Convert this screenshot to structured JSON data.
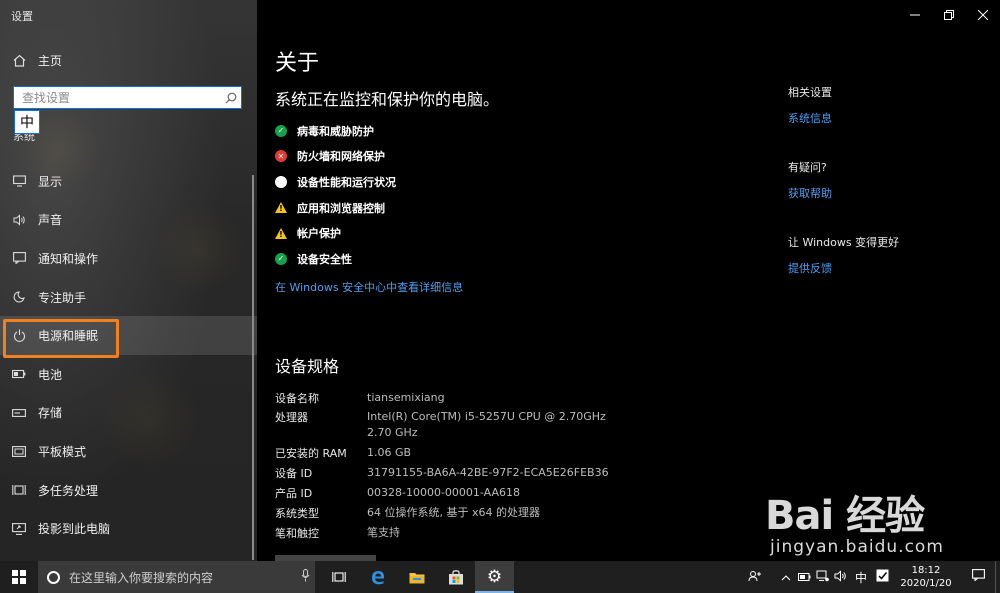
{
  "window": {
    "title": "设置"
  },
  "sidebar": {
    "home_label": "主页",
    "search_placeholder": "查找设置",
    "ime_char": "中",
    "section_label": "系统",
    "items": [
      {
        "label": "显示",
        "icon": "monitor-icon"
      },
      {
        "label": "声音",
        "icon": "speaker-icon"
      },
      {
        "label": "通知和操作",
        "icon": "notification-icon"
      },
      {
        "label": "专注助手",
        "icon": "moon-icon"
      },
      {
        "label": "电源和睡眠",
        "icon": "power-icon",
        "selected": true
      },
      {
        "label": "电池",
        "icon": "battery-icon"
      },
      {
        "label": "存储",
        "icon": "storage-icon"
      },
      {
        "label": "平板模式",
        "icon": "tablet-icon"
      },
      {
        "label": "多任务处理",
        "icon": "multitask-icon"
      },
      {
        "label": "投影到此电脑",
        "icon": "project-icon"
      }
    ]
  },
  "main": {
    "title": "关于",
    "subtitle": "系统正在监控和保护你的电脑。",
    "status": [
      {
        "label": "病毒和威胁防护",
        "state": "ok"
      },
      {
        "label": "防火墙和网络保护",
        "state": "error"
      },
      {
        "label": "设备性能和运行状况",
        "state": "info"
      },
      {
        "label": "应用和浏览器控制",
        "state": "warning"
      },
      {
        "label": "帐户保护",
        "state": "warning"
      },
      {
        "label": "设备安全性",
        "state": "ok"
      }
    ],
    "defender_link": "在 Windows 安全中心中查看详细信息",
    "specs_title": "设备规格",
    "specs": [
      {
        "key": "设备名称",
        "value": "tiansemixiang"
      },
      {
        "key": "处理器",
        "value": "Intel(R) Core(TM) i5-5257U CPU @ 2.70GHz   2.70 GHz"
      },
      {
        "key": "已安装的 RAM",
        "value": "1.06 GB"
      },
      {
        "key": "设备 ID",
        "value": "31791155-BA6A-42BE-97F2-ECA5E26FEB36"
      },
      {
        "key": "产品 ID",
        "value": "00328-10000-00001-AA618"
      },
      {
        "key": "系统类型",
        "value": "64 位操作系统, 基于 x64 的处理器"
      },
      {
        "key": "笔和触控",
        "value": "笔支持"
      }
    ]
  },
  "related": {
    "related_heading": "相关设置",
    "system_info_link": "系统信息",
    "question_heading": "有疑问?",
    "help_link": "获取帮助",
    "improve_heading": "让 Windows 变得更好",
    "feedback_link": "提供反馈"
  },
  "taskbar": {
    "search_placeholder": "在这里输入你要搜索的内容",
    "ime": "中",
    "time": "18:12",
    "date": "2020/1/20"
  },
  "watermark": {
    "logo": "Bai 经验",
    "sub": "jingyan.baidu.com"
  },
  "colors": {
    "accent": "#4c9ff2",
    "highlight": "#f0811e",
    "ok": "#16a34a",
    "error": "#e53935",
    "warning": "#f5c518"
  }
}
